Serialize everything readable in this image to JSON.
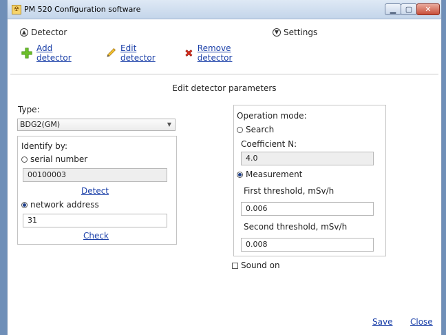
{
  "window": {
    "title": "PM 520 Configuration software"
  },
  "sections": {
    "detector": "Detector",
    "settings": "Settings"
  },
  "toolbar": {
    "add": "Add detector",
    "edit": "Edit detector",
    "remove": "Remove detector"
  },
  "heading": "Edit detector parameters",
  "left": {
    "type_label": "Type:",
    "type_value": "BDG2(GM)",
    "identify_label": "Identify by:",
    "serial_label": "serial number",
    "serial_value": "00100003",
    "detect_link": "Detect",
    "network_label": "network address",
    "network_value": "31",
    "check_link": "Check",
    "serial_checked": false,
    "network_checked": true
  },
  "right": {
    "mode_label": "Operation mode:",
    "search_label": "Search",
    "coef_label": "Coefficient N:",
    "coef_value": "4.0",
    "measurement_label": "Measurement",
    "first_label": "First threshold, mSv/h",
    "first_value": "0.006",
    "second_label": "Second threshold, mSv/h",
    "second_value": "0.008",
    "search_checked": false,
    "measurement_checked": true
  },
  "sound_label": "Sound on",
  "sound_checked": false,
  "footer": {
    "save": "Save",
    "close": "Close"
  },
  "colors": {
    "link": "#1a3fa8",
    "frame": "#6f8fb8",
    "add_icon": "#6cbf2a",
    "remove_icon": "#d62a1a"
  },
  "icons": {
    "add": "plus-icon",
    "edit": "pencil-icon",
    "remove": "red-x-icon"
  }
}
